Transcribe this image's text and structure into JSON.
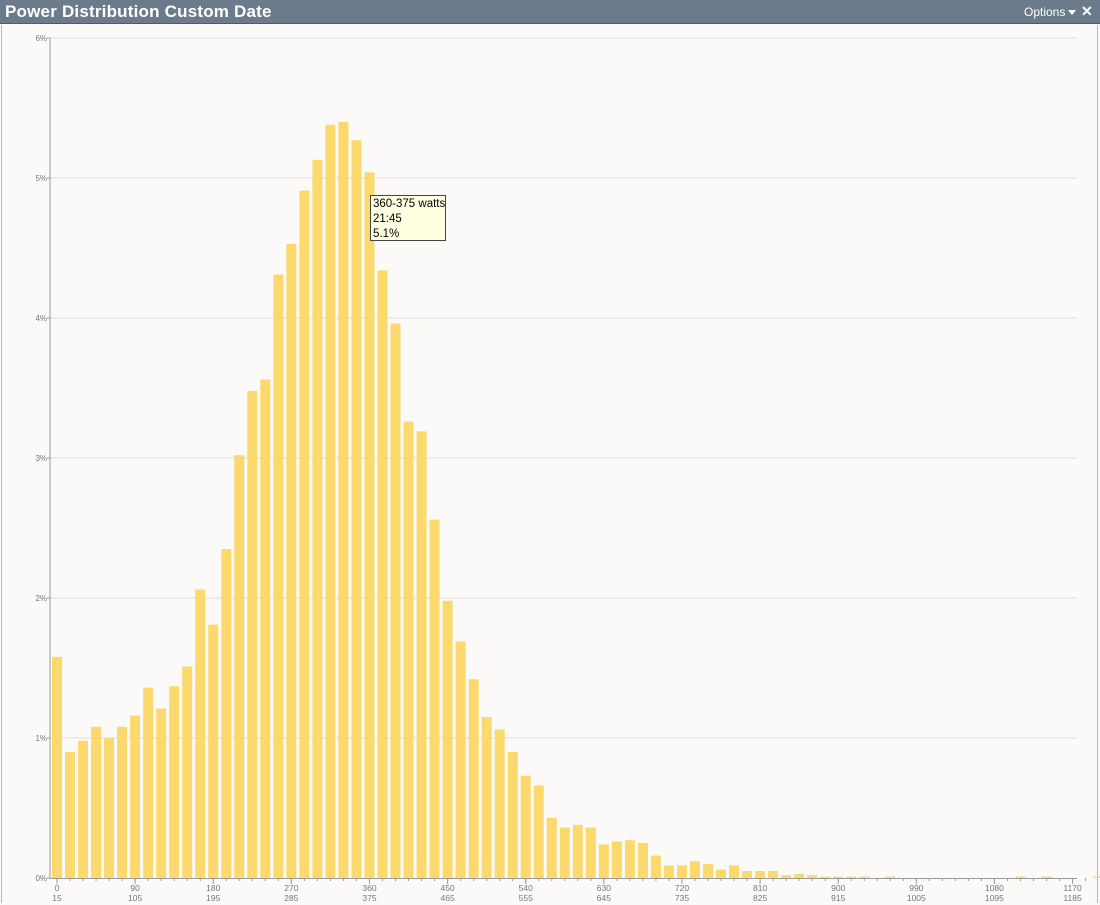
{
  "window": {
    "title": "Power Distribution Custom Date",
    "options_label": "Options",
    "close_symbol": "✕"
  },
  "tooltip": {
    "range": "360-375 watts",
    "time": "21:45",
    "percent": "5.1%"
  },
  "colors": {
    "bar": "#fbd96c",
    "grid": "#dcdcdc",
    "axis": "#9a9a9a",
    "tick_text": "#777777"
  },
  "chart_data": {
    "type": "bar",
    "bin_width": 15,
    "bin_start": 0,
    "ylim": [
      0,
      6
    ],
    "y_unit": "%",
    "y_ticks": [
      "0%",
      "1%",
      "2%",
      "3%",
      "4%",
      "5%",
      "6%"
    ],
    "x_ticks_top": [
      "0",
      "90",
      "180",
      "270",
      "360",
      "450",
      "540",
      "630",
      "720",
      "810",
      "900",
      "990",
      "1080",
      "1170"
    ],
    "x_ticks_bottom": [
      "15",
      "105",
      "195",
      "285",
      "375",
      "465",
      "555",
      "645",
      "735",
      "825",
      "915",
      "1005",
      "1095",
      "1185"
    ],
    "grid": true,
    "legend": "none",
    "values": [
      1.58,
      0.9,
      0.98,
      1.08,
      1.0,
      1.08,
      1.16,
      1.36,
      1.21,
      1.37,
      1.51,
      2.06,
      1.81,
      2.35,
      3.02,
      3.48,
      3.56,
      4.31,
      4.53,
      4.91,
      5.13,
      5.38,
      5.4,
      5.27,
      5.04,
      4.34,
      3.96,
      3.26,
      3.19,
      2.56,
      1.98,
      1.69,
      1.42,
      1.15,
      1.06,
      0.9,
      0.73,
      0.66,
      0.43,
      0.36,
      0.38,
      0.36,
      0.24,
      0.26,
      0.27,
      0.25,
      0.16,
      0.09,
      0.09,
      0.12,
      0.1,
      0.06,
      0.09,
      0.05,
      0.05,
      0.05,
      0.02,
      0.03,
      0.02,
      0.01,
      0.01,
      0.01,
      0.01,
      0,
      0.01,
      0,
      0,
      0,
      0,
      0,
      0,
      0,
      0,
      0,
      0.01,
      0,
      0.01,
      0,
      0,
      0,
      0.01
    ]
  }
}
